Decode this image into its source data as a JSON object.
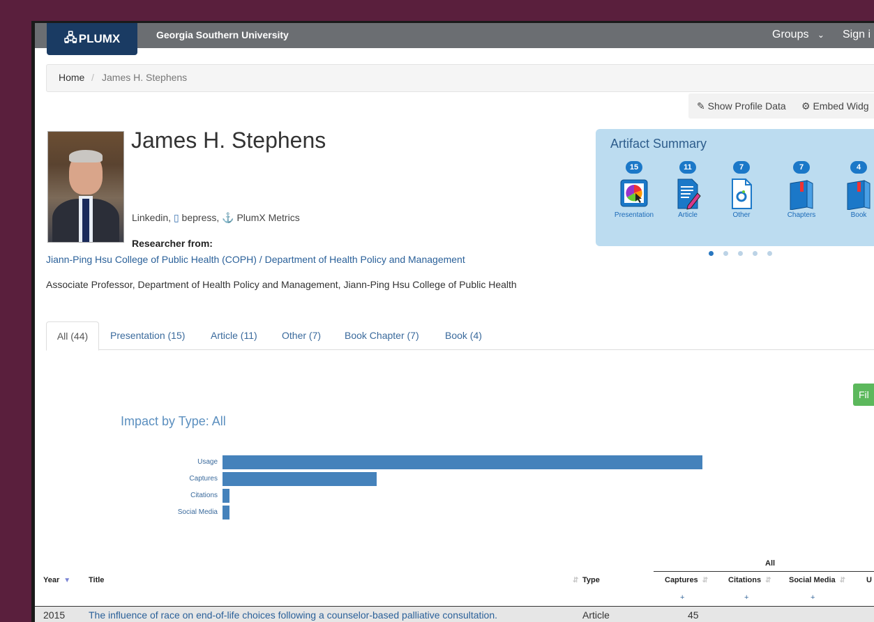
{
  "navbar": {
    "logo": "PLUMX",
    "institution": "Georgia Southern University",
    "groups": "Groups",
    "signin": "Sign i"
  },
  "breadcrumb": {
    "home": "Home",
    "separator": "/",
    "current": "James H. Stephens"
  },
  "profile_actions": {
    "show_profile": "Show Profile Data",
    "embed": "Embed Widg"
  },
  "profile": {
    "name": "James H. Stephens",
    "links": {
      "linkedin": "Linkedin,",
      "bepress": "bepress,",
      "plumx": "PlumX Metrics"
    },
    "researcher_from_label": "Researcher from:",
    "department_link": "Jiann-Ping Hsu College of Public Health (COPH) / Department of Health Policy and Management",
    "position": "Associate Professor, Department of Health Policy and Management, Jiann-Ping Hsu College of Public Health"
  },
  "artifact_summary": {
    "title": "Artifact Summary",
    "items": [
      {
        "count": "15",
        "label": "Presentation",
        "icon": "presentation-icon"
      },
      {
        "count": "11",
        "label": "Article",
        "icon": "article-icon"
      },
      {
        "count": "7",
        "label": "Other",
        "icon": "other-icon"
      },
      {
        "count": "7",
        "label": "Chapters",
        "icon": "chapters-icon"
      },
      {
        "count": "4",
        "label": "Book",
        "icon": "book-icon"
      }
    ],
    "pages": 5,
    "active_page": 1
  },
  "tabs": [
    {
      "label": "All (44)",
      "active": true
    },
    {
      "label": "Presentation (15)"
    },
    {
      "label": "Article (11)"
    },
    {
      "label": "Other (7)"
    },
    {
      "label": "Book Chapter (7)"
    },
    {
      "label": "Book (4)"
    }
  ],
  "filter_button": "Fil",
  "impact": {
    "label": "Impact by Type:",
    "value": "All"
  },
  "chart_data": {
    "type": "bar",
    "orientation": "horizontal",
    "categories": [
      "Usage",
      "Captures",
      "Citations",
      "Social Media"
    ],
    "values": [
      140,
      45,
      2,
      2
    ]
  },
  "table": {
    "group_header": "All",
    "headers": {
      "year": "Year",
      "title": "Title",
      "type": "Type",
      "captures": "Captures",
      "citations": "Citations",
      "social": "Social Media",
      "usage": "U"
    },
    "plus": "+",
    "rows": [
      {
        "year": "2015",
        "title": "The influence of race on end-of-life choices following a counselor-based palliative consultation.",
        "type": "Article",
        "captures": "45"
      }
    ]
  },
  "colors": {
    "background": "#5a1f3d",
    "navbar": "#6b6e72",
    "logo": "#1a3b63",
    "bar": "#4582bb",
    "accent": "#1b78c8",
    "summary_bg": "#bcdcf0",
    "filter": "#5cb85c"
  }
}
